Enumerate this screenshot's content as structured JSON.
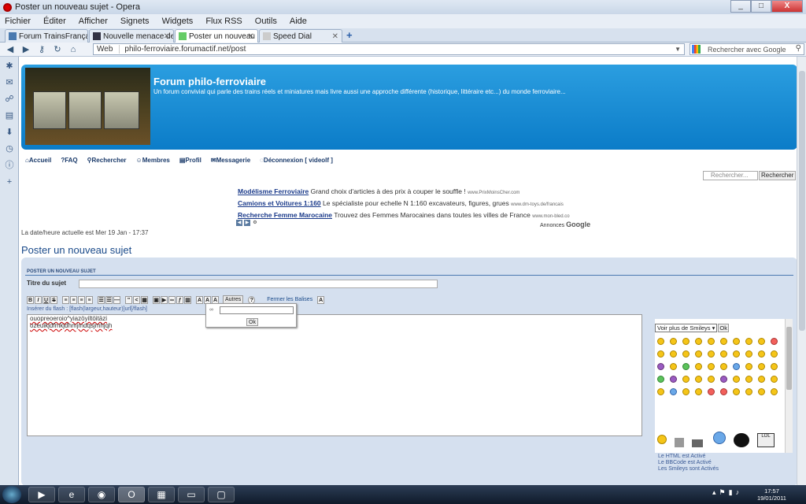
{
  "window": {
    "title": "Poster un nouveau sujet - Opera",
    "min": "_",
    "max": "□",
    "close": "X"
  },
  "menu": [
    "Fichier",
    "Éditer",
    "Afficher",
    "Signets",
    "Widgets",
    "Flux RSS",
    "Outils",
    "Aide"
  ],
  "tabs": [
    {
      "label": "Forum TrainsFrançais -..."
    },
    {
      "label": "Nouvelle menace de fe..."
    },
    {
      "label": "Poster un nouveau sujet"
    },
    {
      "label": "Speed Dial"
    }
  ],
  "address": {
    "prefix": "Web",
    "url": "philo-ferroviaire.forumactif.net/post"
  },
  "search": {
    "placeholder": "Rechercher avec Google"
  },
  "forum": {
    "title": "Forum philo-ferroviaire",
    "subtitle": "Un forum convivial qui parle des trains réels et miniatures mais livre aussi une approche différente (historique, littéraire etc...) du monde ferroviaire...",
    "nav": [
      "Accueil",
      "FAQ",
      "Rechercher",
      "Membres",
      "Profil",
      "Messagerie",
      "Déconnexion [ videolf ]"
    ],
    "search_placeholder": "Rechercher...",
    "search_button": "Rechercher"
  },
  "ads": [
    {
      "title": "Modélisme Ferroviaire",
      "desc": "Grand choix d'articles à des prix à couper le souffle !",
      "url": "www.PrixMoinsCher.com"
    },
    {
      "title": "Camions et Voitures 1:160",
      "desc": "Le spécialiste pour echelle N 1:160 excavateurs, figures, grues",
      "url": "www.dm-toys.de/francais"
    },
    {
      "title": "Recherche Femme Marocaine",
      "desc": "Trouvez des Femmes Marocaines dans toutes les villes de France",
      "url": "www.mon-bled.co"
    }
  ],
  "ad_label": "Annonces",
  "ad_brand": "Google",
  "datetime": "La date/heure actuelle est Mer 19 Jan - 17:37",
  "page_title": "Poster un nouveau sujet",
  "post": {
    "section": "POSTER UN NOUVEAU SUJET",
    "subject_label": "Titre du sujet",
    "subject_value": "",
    "autres": "Autres",
    "fermer": "Fermer les Balises",
    "flash_hint": "Insérer du flash : [flash(largeur,hauteur)]url[/flash]",
    "editor_lines": [
      "ouopreoeroio^yiazöyiltöitäzi",
      "ozeuikjdfmkjdhmjmdqsjmhjqh"
    ],
    "popup_ok": "Ok",
    "smiley_select": "Voir plus de Smileys",
    "smiley_ok": "Ok",
    "status": [
      "Le HTML est Activé",
      "Le BBCode est Activé",
      "Les Smileys sont Activés"
    ]
  },
  "clock": {
    "time": "17:57",
    "date": "19/01/2011"
  }
}
